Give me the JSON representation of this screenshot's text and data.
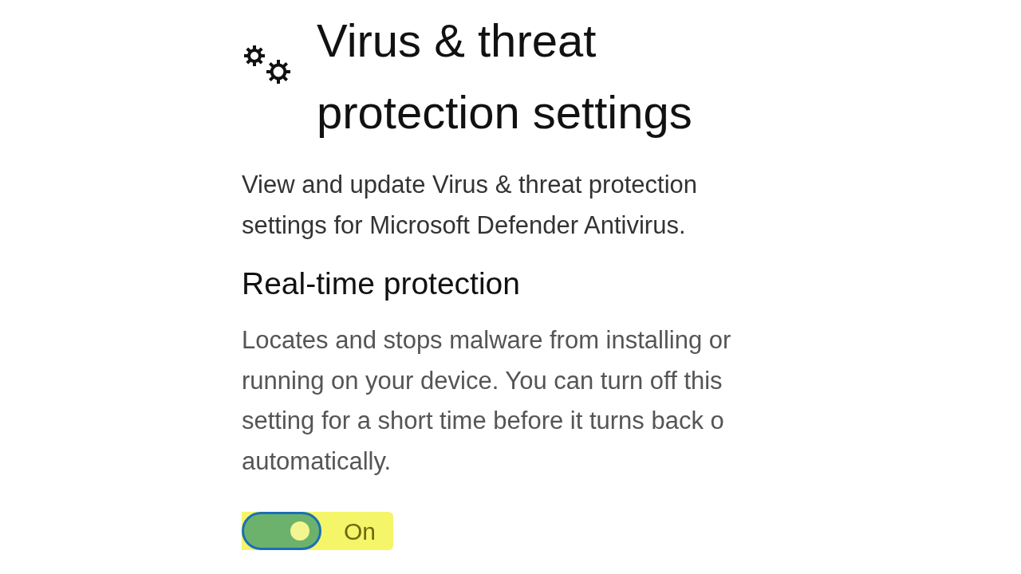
{
  "title_lines": [
    "Virus & threat",
    "protection settings"
  ],
  "description_lines": [
    "View and update Virus & threat protection",
    "settings for Microsoft Defender Antivirus."
  ],
  "section": {
    "heading": "Real-time protection",
    "body_lines": [
      "Locates and stops malware from installing or",
      "running on your device. You can turn off this",
      "setting for a short time before it turns back o",
      "automatically."
    ],
    "toggle": {
      "on": true,
      "highlighted": true,
      "label": "On"
    }
  }
}
